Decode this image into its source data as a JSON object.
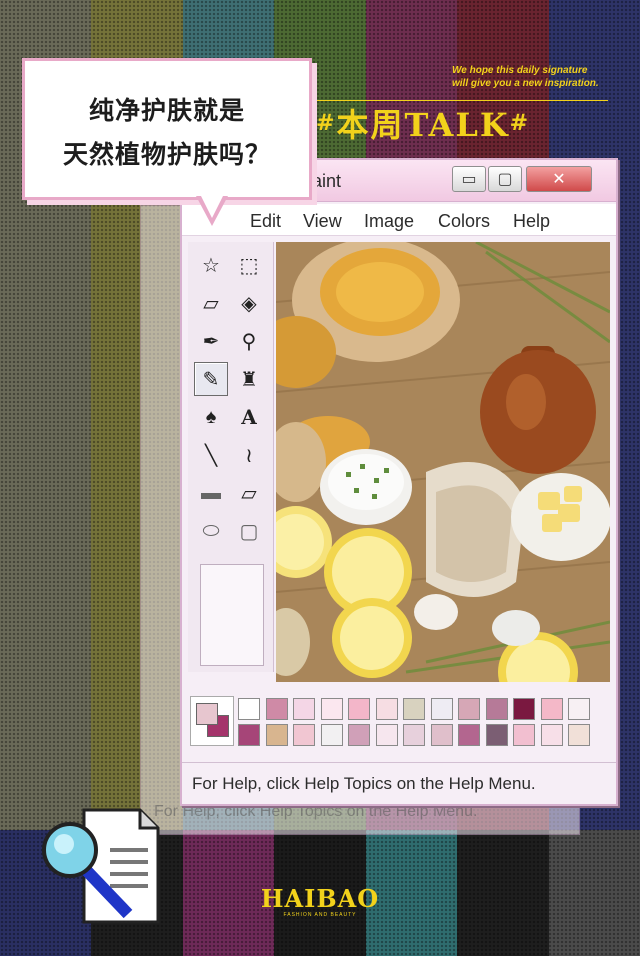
{
  "header": {
    "tagline_line1": "We hope this daily signature",
    "tagline_line2": "will give you a new inspiration.",
    "weekly_hash_left": "#",
    "weekly_title": "本周TALK",
    "weekly_hash_right": "#"
  },
  "bubble": {
    "line1": "纯净护肤就是",
    "line2": "天然植物护肤吗？"
  },
  "window": {
    "title": "Paint",
    "min_glyph": "▭",
    "max_glyph": "▢",
    "close_glyph": "✕"
  },
  "menu": [
    "Edit",
    "View",
    "Image",
    "Colors",
    "Help"
  ],
  "tools": [
    {
      "name": "free-select-icon",
      "glyph": "☆"
    },
    {
      "name": "rect-select-icon",
      "glyph": "⬚"
    },
    {
      "name": "eraser-icon",
      "glyph": "▱"
    },
    {
      "name": "fill-bucket-icon",
      "glyph": "◈"
    },
    {
      "name": "color-picker-icon",
      "glyph": "✒"
    },
    {
      "name": "magnifier-icon",
      "glyph": "⚲"
    },
    {
      "name": "pencil-icon",
      "glyph": "✎"
    },
    {
      "name": "brush-icon",
      "glyph": "♜"
    },
    {
      "name": "airbrush-icon",
      "glyph": "♠"
    },
    {
      "name": "text-icon",
      "glyph": "A"
    },
    {
      "name": "line-icon",
      "glyph": "╲"
    },
    {
      "name": "curve-icon",
      "glyph": "≀"
    },
    {
      "name": "rectangle-icon",
      "glyph": "▬"
    },
    {
      "name": "polygon-icon",
      "glyph": "▱"
    },
    {
      "name": "ellipse-icon",
      "glyph": "⬭"
    },
    {
      "name": "rounded-rect-icon",
      "glyph": "▢"
    }
  ],
  "palette": {
    "foreground": "#e7c6cf",
    "background": "#a4346b",
    "row1": [
      "#ffffff",
      "#cf8aa6",
      "#f4d6e6",
      "#fbe7ef",
      "#f3b6c9",
      "#f6dde3",
      "#d8d2bf",
      "#eeecf3",
      "#d6a7b6",
      "#b67a98",
      "#7a1840",
      "#f4b8c8",
      "#f7f0f3"
    ],
    "row2": [
      "#a64578",
      "#d8b58f",
      "#f1c6d2",
      "#f2f0f2",
      "#d0a0b8",
      "#f6e6ee",
      "#e7d0dc",
      "#e0bfcb",
      "#b3668f",
      "#7b5e73",
      "#f2bfd0",
      "#f7dfe8",
      "#f1e0d8"
    ]
  },
  "status": {
    "help_text": "For Help, click Help Topics on the Help Menu.",
    "ghost_text": "For Help, click Help Topics on the Help Menu."
  },
  "brand": {
    "name": "HAIBAO",
    "subtitle": "FASHION AND BEAUTY"
  }
}
